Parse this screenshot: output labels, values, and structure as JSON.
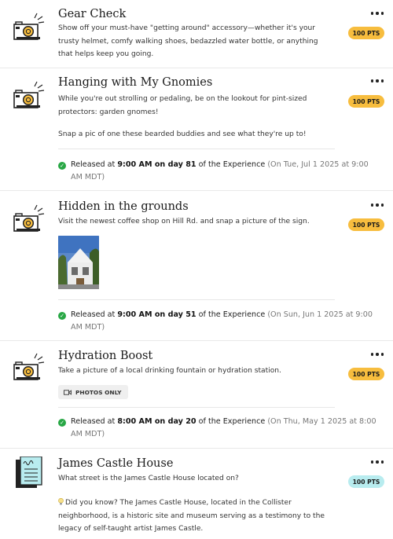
{
  "colors": {
    "points_badge": "#f7bd3e",
    "points_badge_quiz": "#b8ecef",
    "check_green": "#28a745"
  },
  "cards": [
    {
      "icon": "camera-icon",
      "title": "Gear Check",
      "desc": "Show off your must-have \"getting around\" accessory—whether it's your trusty helmet, comfy walking shoes, bedazzled water bottle, or anything that helps keep you going.",
      "points": "100 PTS"
    },
    {
      "icon": "camera-icon",
      "title": "Hanging with My Gnomies",
      "desc": "While you're out strolling or pedaling, be on the lookout for pint-sized protectors: garden gnomes!",
      "desc2": "Snap a pic of one these bearded buddies and see what they're up to!",
      "points": "100 PTS",
      "release": {
        "prefix": "Released at ",
        "time_day": "9:00 AM on day 81",
        "middle": " of the Experience ",
        "date": "(On Tue, Jul 1 2025 at 9:00 AM MDT)"
      }
    },
    {
      "icon": "camera-icon",
      "title": "Hidden in the grounds",
      "desc": "Visit the newest coffee shop on Hill Rd. and snap a picture of the sign.",
      "points": "100 PTS",
      "release": {
        "prefix": "Released at ",
        "time_day": "9:00 AM on day 51",
        "middle": " of the Experience ",
        "date": "(On Sun, Jun 1 2025 at 9:00 AM MDT)"
      }
    },
    {
      "icon": "camera-icon",
      "title": "Hydration Boost",
      "desc": "Take a picture of a local drinking fountain or hydration station.",
      "chip": "PHOTOS ONLY",
      "points": "100 PTS",
      "release": {
        "prefix": "Released at ",
        "time_day": "8:00 AM on day 20",
        "middle": " of the Experience ",
        "date": "(On Thu, May 1 2025 at 8:00 AM MDT)"
      }
    },
    {
      "icon": "quiz-document-icon",
      "title": "James Castle House",
      "desc": "What street is the James Castle House located on?",
      "points": "100 PTS",
      "did_you_know": "Did you know? The James Castle House, located in the Collister neighborhood, is a historic site and museum serving as a testimony to the legacy of self-taught artist James Castle."
    }
  ]
}
